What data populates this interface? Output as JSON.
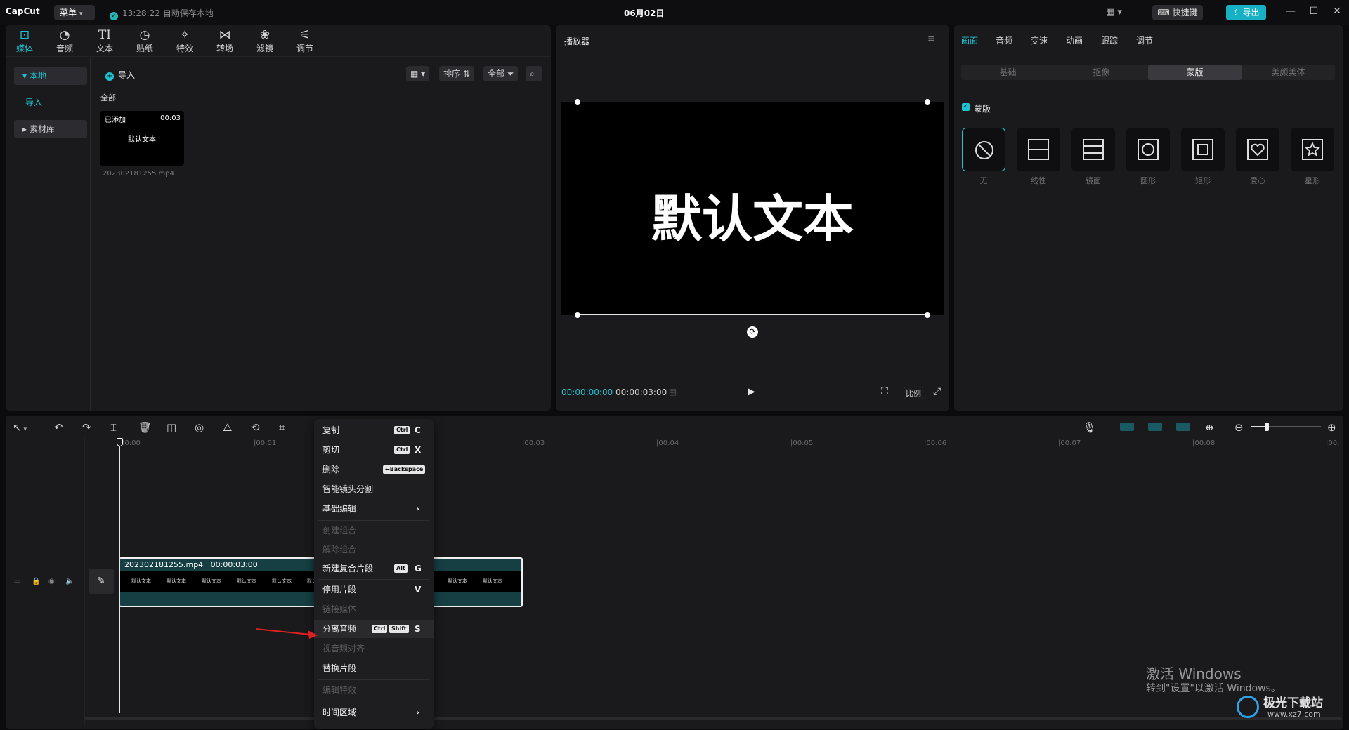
{
  "titlebar": {
    "logo": "CapCut",
    "menu_label": "菜单",
    "autosave": "13:28:22 自动保存本地",
    "date": "06月02日",
    "shortcut_label": "快捷键",
    "export_label": "导出"
  },
  "media_tools": [
    {
      "label": "媒体",
      "icon": "media-icon"
    },
    {
      "label": "音频",
      "icon": "audio-icon"
    },
    {
      "label": "文本",
      "icon": "text-icon"
    },
    {
      "label": "贴纸",
      "icon": "sticker-icon"
    },
    {
      "label": "特效",
      "icon": "effects-icon"
    },
    {
      "label": "转场",
      "icon": "transition-icon"
    },
    {
      "label": "滤镜",
      "icon": "filter-icon"
    },
    {
      "label": "调节",
      "icon": "adjust-icon"
    }
  ],
  "media_sidebar": {
    "local": "本地",
    "import": "导入",
    "library": "素材库"
  },
  "media_toolbar": {
    "import": "导入",
    "sort": "排序",
    "filter": "全部",
    "section": "全部"
  },
  "media_clip": {
    "added": "已添加",
    "duration": "00:03",
    "thumb_text": "默认文本",
    "filename": "202302181255.mp4"
  },
  "player": {
    "title": "播放器",
    "preview_text": "默认文本",
    "current_time": "00:00:00:00",
    "total_time": "00:00:03:00",
    "ratio_label": "比例"
  },
  "right_panel": {
    "tabs": [
      "画面",
      "音频",
      "变速",
      "动画",
      "跟踪",
      "调节"
    ],
    "subtabs": [
      "基础",
      "抠像",
      "蒙版",
      "美颜美体"
    ],
    "mask_title": "蒙版",
    "masks": [
      "无",
      "线性",
      "镜面",
      "圆形",
      "矩形",
      "爱心",
      "星形"
    ]
  },
  "timeline": {
    "ticks": [
      "00:00",
      "00:01",
      "00:03",
      "00:04",
      "00:05",
      "00:06",
      "00:07",
      "00:08",
      "00:"
    ],
    "clip_label": "202302181255.mp4   00:00:03:00",
    "clip_frame_text": "默认文本"
  },
  "context_menu": {
    "items": [
      {
        "label": "复制",
        "mods": [
          "Ctrl"
        ],
        "key": "C",
        "disabled": false
      },
      {
        "label": "剪切",
        "mods": [
          "Ctrl"
        ],
        "key": "X",
        "disabled": false
      },
      {
        "label": "删除",
        "mods": [
          "←Backspace"
        ],
        "key": "",
        "disabled": false
      },
      {
        "label": "智能镜头分割",
        "mods": [],
        "key": "",
        "disabled": false
      },
      {
        "label": "基础编辑",
        "mods": [],
        "key": "›",
        "disabled": false
      },
      {
        "label": "创建组合",
        "mods": [],
        "key": "",
        "disabled": true
      },
      {
        "label": "解除组合",
        "mods": [],
        "key": "",
        "disabled": true
      },
      {
        "label": "新建复合片段",
        "mods": [
          "Alt"
        ],
        "key": "G",
        "disabled": false
      },
      {
        "label": "停用片段",
        "mods": [],
        "key": "V",
        "disabled": false
      },
      {
        "label": "链接媒体",
        "mods": [],
        "key": "",
        "disabled": true
      },
      {
        "label": "分离音频",
        "mods": [
          "Ctrl",
          "Shift"
        ],
        "key": "S",
        "disabled": false
      },
      {
        "label": "视音频对齐",
        "mods": [],
        "key": "",
        "disabled": true
      },
      {
        "label": "替换片段",
        "mods": [],
        "key": "",
        "disabled": false
      },
      {
        "label": "编辑特效",
        "mods": [],
        "key": "",
        "disabled": true
      },
      {
        "label": "时间区域",
        "mods": [],
        "key": "›",
        "disabled": false
      }
    ]
  },
  "watermark": {
    "activate_title": "激活 Windows",
    "activate_sub": "转到\"设置\"以激活 Windows。",
    "site_name": "极光下载站",
    "site_url": "www.xz7.com"
  },
  "colors": {
    "accent": "#1fc2d2",
    "export": "#16b1c4",
    "arrow": "#e02020"
  }
}
